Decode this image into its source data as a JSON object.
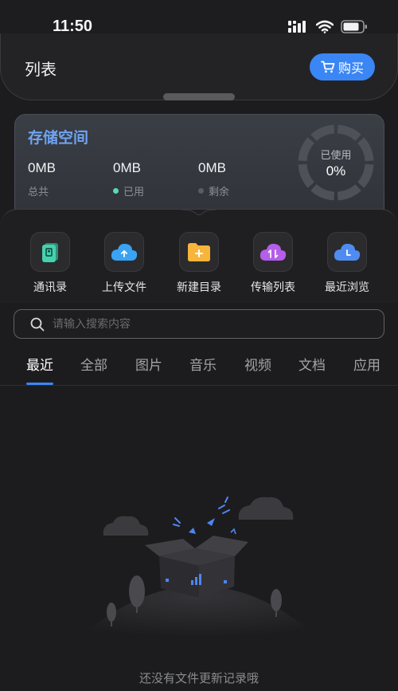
{
  "status": {
    "time": "11:50"
  },
  "header": {
    "title": "列表",
    "buy_label": "购买"
  },
  "storage": {
    "title": "存储空间",
    "total": {
      "value": "0MB",
      "label": "总共"
    },
    "used": {
      "value": "0MB",
      "label": "已用",
      "dot_color": "#5ad8b4"
    },
    "remaining": {
      "value": "0MB",
      "label": "剩余",
      "dot_color": "#5a5c62"
    },
    "gauge_label": "已使用",
    "gauge_percent": "0%",
    "gauge_fraction": 0
  },
  "quick_actions": [
    {
      "label": "通讯录",
      "icon": "contacts-icon",
      "color": "#3fc9a8"
    },
    {
      "label": "上传文件",
      "icon": "cloud-upload-icon",
      "color": "#3a9cf0"
    },
    {
      "label": "新建目录",
      "icon": "new-folder-icon",
      "color": "#f6b23a"
    },
    {
      "label": "传输列表",
      "icon": "transfer-icon",
      "color": "#b05ce8"
    },
    {
      "label": "最近浏览",
      "icon": "recent-clock-icon",
      "color": "#4d86f0"
    }
  ],
  "search": {
    "placeholder": "请输入搜索内容"
  },
  "tabs": [
    "最近",
    "全部",
    "图片",
    "音乐",
    "视频",
    "文档",
    "应用"
  ],
  "active_tab": "最近",
  "empty": {
    "message": "还没有文件更新记录哦"
  },
  "colors": {
    "accent": "#3a86f5",
    "background": "#1c1c1e"
  }
}
